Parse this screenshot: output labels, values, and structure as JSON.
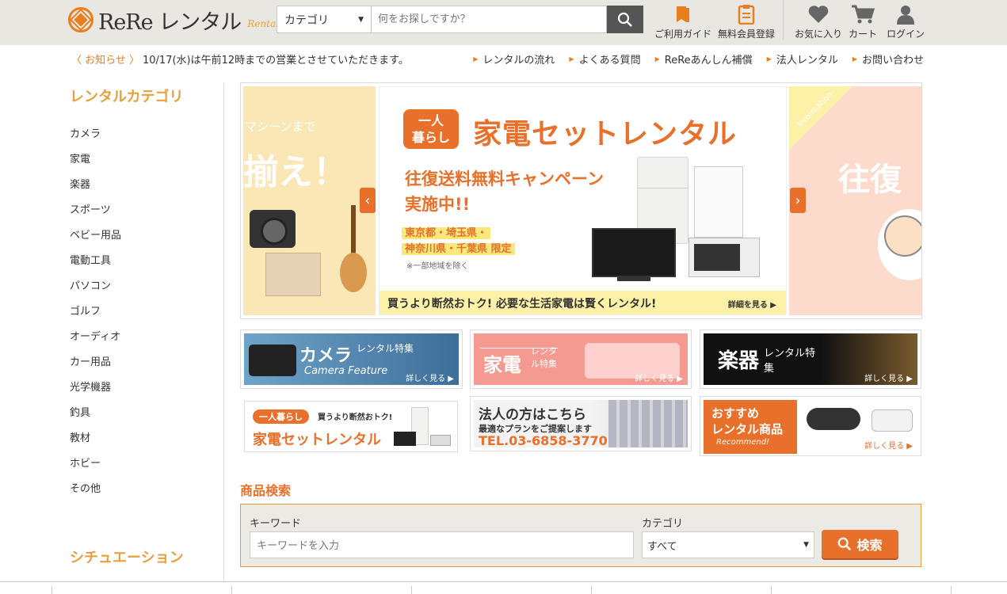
{
  "header": {
    "logo_text": "ReRe レンタル",
    "logo_sub": "Rental",
    "category_select": "カテゴリ",
    "search_placeholder": "何をお探しですか？",
    "icons": [
      {
        "label": "ご利用ガイド",
        "icon": "book-icon"
      },
      {
        "label": "無料会員登録",
        "icon": "clipboard-icon"
      },
      {
        "label": "お気に入り",
        "icon": "heart-icon"
      },
      {
        "label": "カート",
        "icon": "cart-icon"
      },
      {
        "label": "ログイン",
        "icon": "user-icon"
      }
    ]
  },
  "infobar": {
    "news_label": "〈 お知らせ 〉",
    "news_text": "10/17(水)は午前12時までの営業とさせていただきます。",
    "links": [
      "レンタルの流れ",
      "よくある質問",
      "ReReあんしん補償",
      "法人レンタル",
      "お問い合わせ"
    ]
  },
  "sidebar": {
    "title": "レンタルカテゴリ",
    "items": [
      "カメラ",
      "家電",
      "楽器",
      "スポーツ",
      "ベビー用品",
      "電動工具",
      "パソコン",
      "ゴルフ",
      "オーディオ",
      "カー用品",
      "光学機器",
      "釣具",
      "教材",
      "ホビー",
      "その他"
    ],
    "title2": "シチュエーション"
  },
  "carousel": {
    "left": {
      "line1": "マシーンまで",
      "line2": "揃え！"
    },
    "main": {
      "badge": "一人\n暮らし",
      "title": "家電セットレンタル",
      "campaign_1": "往復送料無料キャンペーン",
      "campaign_2": "実施中!!",
      "area_1": "東京都・埼玉県・",
      "area_2": "神奈川県・千葉県 限定",
      "note": "※一部地域を除く",
      "strip": "買うより断然おトク! 必要な生活家電は賢くレンタル!",
      "strip_more": "詳細を見る ▶"
    },
    "right": {
      "info": "Information",
      "title": "往復"
    },
    "prev": "‹",
    "next": "›"
  },
  "banners": {
    "camera": {
      "title": "カメラ",
      "sub": "レンタル特集",
      "en": "Camera Feature",
      "more": "詳しく見る ▶"
    },
    "appliance": {
      "title": "家電",
      "sub": "レンタル特集",
      "more": "詳しく見る ▶"
    },
    "instrument": {
      "title": "楽器",
      "sub": "レンタル特集",
      "more": "詳しく見る ▶"
    },
    "set": {
      "badge": "一人暮らし",
      "tag": "買うより断然おトク!",
      "title": "家電セットレンタル"
    },
    "corp": {
      "title": "法人の方はこちら",
      "sub": "最適なプランをご提案します",
      "tel": "TEL.03-6858-3770"
    },
    "recommend": {
      "title1": "おすすめ",
      "title2": "レンタル商品",
      "en": "Recommend!",
      "more": "詳しく見る ▶"
    }
  },
  "product_search": {
    "title": "商品検索",
    "keyword_label": "キーワード",
    "keyword_placeholder": "キーワードを入力",
    "category_label": "カテゴリ",
    "category_value": "すべて",
    "button": "検索"
  }
}
